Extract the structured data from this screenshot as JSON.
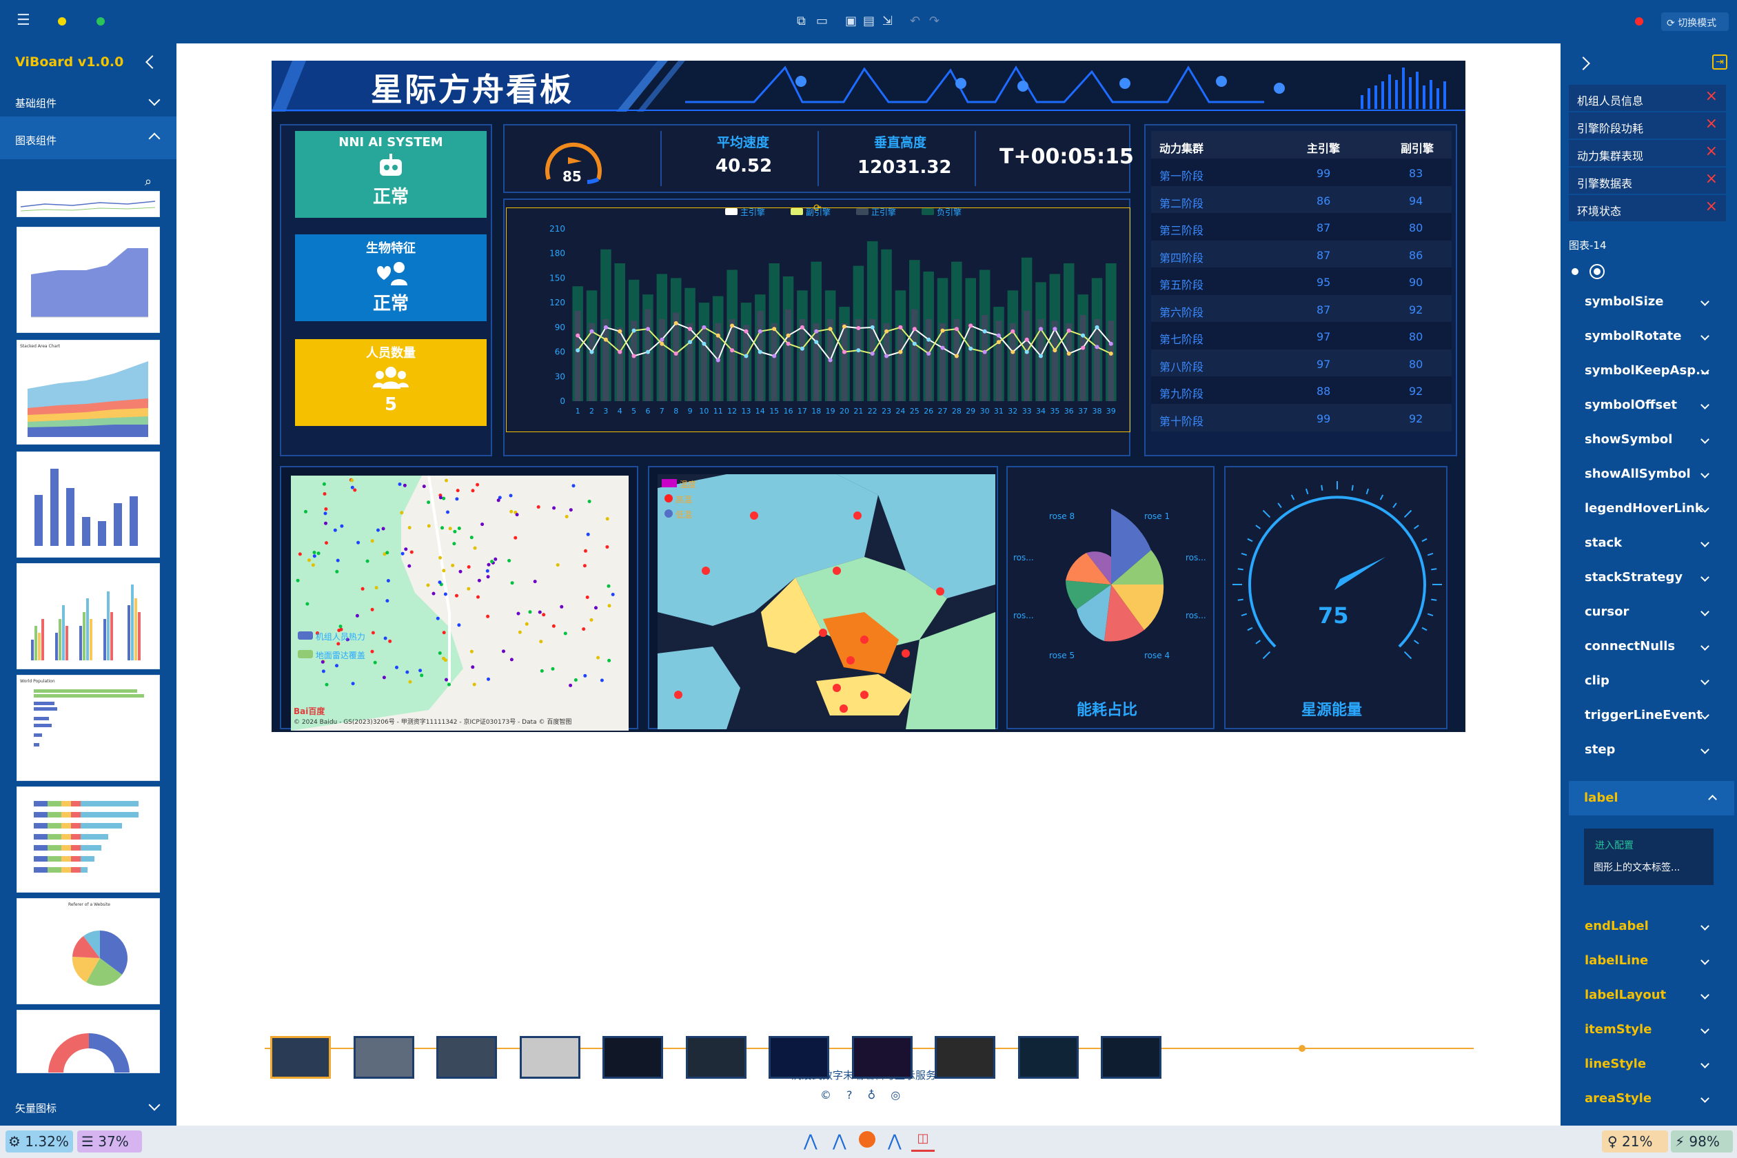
{
  "toolbar": {
    "right_label": "切换模式"
  },
  "left": {
    "title": "ViBoard v1.0.0",
    "sections": [
      "基础组件",
      "图表组件",
      "矢量图标"
    ]
  },
  "dashboard": {
    "title": "星际方舟看板",
    "status": [
      {
        "title": "NNI AI SYSTEM",
        "value": "正常",
        "color": "#27a79a"
      },
      {
        "title": "生物特征",
        "value": "正常",
        "color": "#0a78c8"
      },
      {
        "title": "人员数量",
        "value": "5",
        "color": "#f5c000"
      }
    ],
    "gauge_small": "85",
    "avg_speed_label": "平均速度",
    "avg_speed": "40.52",
    "altitude_label": "垂直高度",
    "altitude": "12031.32",
    "timer": "T+00:05:15",
    "legend": [
      "主引擎",
      "副引擎",
      "正引擎",
      "负引擎"
    ],
    "table": {
      "headers": [
        "动力集群",
        "主引擎",
        "副引擎"
      ],
      "rows": [
        [
          "第一阶段",
          "99",
          "83"
        ],
        [
          "第二阶段",
          "86",
          "94"
        ],
        [
          "第三阶段",
          "87",
          "80"
        ],
        [
          "第四阶段",
          "87",
          "86"
        ],
        [
          "第五阶段",
          "95",
          "90"
        ],
        [
          "第六阶段",
          "87",
          "92"
        ],
        [
          "第七阶段",
          "97",
          "80"
        ],
        [
          "第八阶段",
          "97",
          "80"
        ],
        [
          "第九阶段",
          "88",
          "92"
        ],
        [
          "第十阶段",
          "99",
          "92"
        ]
      ]
    },
    "map1_legend": [
      "机组人员热力",
      "地面雷达覆盖"
    ],
    "map1_copyright": "© 2024 Baidu - GS(2023)3206号 - 甲测资字11111342 - 京ICP证030173号 - Data © 百度智图",
    "map1_logo": "Bai百度",
    "map2_legend": [
      "温度",
      "高温",
      "低温"
    ],
    "rose_labels": [
      "rose 8",
      "rose 1",
      "ros...",
      "ros...",
      "ros...",
      "ros...",
      "rose 5",
      "rose 4"
    ],
    "rose_title": "能耗占比",
    "gauge_big": "75",
    "gauge_title": "星源能量"
  },
  "chart_data": {
    "type": "bar",
    "categories": [
      "1",
      "2",
      "3",
      "4",
      "5",
      "6",
      "7",
      "8",
      "9",
      "10",
      "11",
      "12",
      "13",
      "14",
      "15",
      "16",
      "17",
      "18",
      "19",
      "20",
      "21",
      "22",
      "23",
      "24",
      "25",
      "26",
      "27",
      "28",
      "29",
      "30",
      "31",
      "32",
      "33",
      "34",
      "35",
      "36",
      "37",
      "38",
      "39"
    ],
    "ylim": [
      0,
      210
    ],
    "yticks": [
      0,
      30,
      60,
      90,
      120,
      150,
      180,
      210
    ],
    "series": [
      {
        "name": "主引擎",
        "type": "line",
        "values": [
          80,
          60,
          90,
          85,
          55,
          60,
          75,
          95,
          88,
          70,
          50,
          92,
          85,
          60,
          55,
          80,
          90,
          72,
          50,
          91,
          89,
          90,
          55,
          60,
          88,
          75,
          65,
          55,
          92,
          85,
          80,
          60,
          75,
          55,
          88,
          58,
          65,
          90,
          70
        ]
      },
      {
        "name": "副引擎",
        "type": "line",
        "values": [
          62,
          85,
          75,
          60,
          86,
          88,
          70,
          58,
          72,
          90,
          80,
          62,
          55,
          85,
          88,
          70,
          64,
          85,
          88,
          60,
          62,
          58,
          85,
          90,
          70,
          58,
          86,
          88,
          64,
          60,
          72,
          85,
          60,
          88,
          62,
          86,
          80,
          66,
          58
        ]
      },
      {
        "name": "正引擎",
        "type": "bar",
        "values": [
          140,
          135,
          185,
          168,
          148,
          130,
          155,
          150,
          138,
          120,
          128,
          160,
          120,
          130,
          168,
          152,
          135,
          170,
          135,
          115,
          165,
          195,
          185,
          135,
          172,
          158,
          150,
          170,
          150,
          160,
          115,
          135,
          175,
          145,
          155,
          168,
          130,
          150,
          168
        ]
      },
      {
        "name": "负引擎",
        "type": "bar",
        "values": [
          110,
          95,
          100,
          90,
          98,
          112,
          100,
          108,
          95,
          92,
          95,
          100,
          93,
          110,
          95,
          112,
          100,
          95,
          100,
          95,
          100,
          100,
          95,
          93,
          112,
          100,
          95,
          100,
          95,
          105,
          98,
          95,
          110,
          100,
          98,
          95,
          105,
          100,
          98
        ]
      }
    ]
  },
  "right": {
    "tags": [
      "机组人员信息",
      "引擎阶段功耗",
      "动力集群表现",
      "引擎数据表",
      "环境状态"
    ],
    "chart_name": "图表-14",
    "props": [
      "symbolSize",
      "symbolRotate",
      "symbolKeepAsp...",
      "symbolOffset",
      "showSymbol",
      "showAllSymbol",
      "legendHoverLink",
      "stack",
      "stackStrategy",
      "cursor",
      "connectNulls",
      "clip",
      "triggerLineEvent",
      "step"
    ],
    "expanded_prop": "label",
    "enter_config": "进入配置",
    "config_desc": "图形上的文本标签...",
    "props2": [
      "endLabel",
      "labelLine",
      "labelLayout",
      "itemStyle",
      "lineStyle",
      "areaStyle"
    ]
  },
  "footer": {
    "caption": "沉浸式数字末端编辑与显示服务"
  },
  "status": {
    "cpu": "1.32%",
    "mem": "37%",
    "bulb": "21%",
    "battery": "98%"
  }
}
